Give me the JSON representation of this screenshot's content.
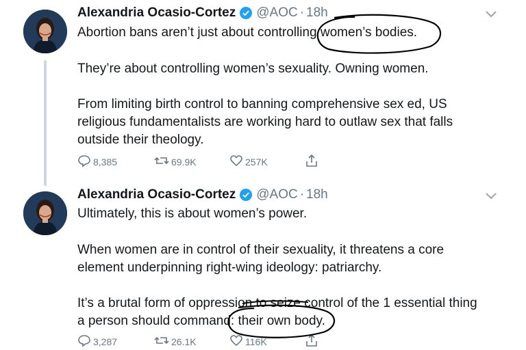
{
  "tweets": [
    {
      "author_name": "Alexandria Ocasio-Cortez",
      "handle": "@AOC",
      "separator": "·",
      "time": "18h",
      "paragraphs": [
        "Abortion bans aren’t just about controlling women’s bodies.",
        "They’re about controlling women’s sexuality. Owning women.",
        "From limiting birth control to banning comprehensive sex ed, US",
        "religious fundamentalists are working hard to outlaw sex that falls",
        "outside their theology."
      ],
      "replies": "8,385",
      "retweets": "69.9K",
      "likes": "257K"
    },
    {
      "author_name": "Alexandria Ocasio-Cortez",
      "handle": "@AOC",
      "separator": "·",
      "time": "18h",
      "paragraphs": [
        "Ultimately, this is about women’s power.",
        "When women are in control of their sexuality, it threatens a core",
        "element underpinning right-wing ideology: patriarchy.",
        "It’s a brutal form of oppression to seize control of the 1 essential thing",
        "a person should command: their own body."
      ],
      "replies": "3,287",
      "retweets": "26.1K",
      "likes": "116K"
    }
  ],
  "colors": {
    "text": "#14171a",
    "muted": "#657786",
    "verified": "#1da1f2",
    "thread_line": "#ccd6dd",
    "annotation_ink": "#000000"
  },
  "icons": [
    "verified-badge-icon",
    "chevron-down-icon",
    "reply-icon",
    "retweet-icon",
    "like-icon",
    "share-icon"
  ]
}
